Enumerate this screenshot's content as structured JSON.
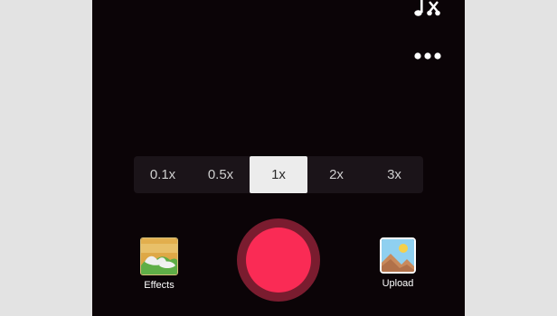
{
  "icons": {
    "music": "music-note-icon",
    "cut": "scissors-icon",
    "more": "more-icon"
  },
  "speed": {
    "options": [
      "0.1x",
      "0.5x",
      "1x",
      "2x",
      "3x"
    ],
    "selected": "1x"
  },
  "effects": {
    "label": "Effects",
    "icon": "effects-thumbnail"
  },
  "upload": {
    "label": "Upload",
    "icon": "image-icon"
  },
  "colors": {
    "record": "#fa2b55",
    "record_ring": "#7a1c2f",
    "background": "#0b0407"
  }
}
